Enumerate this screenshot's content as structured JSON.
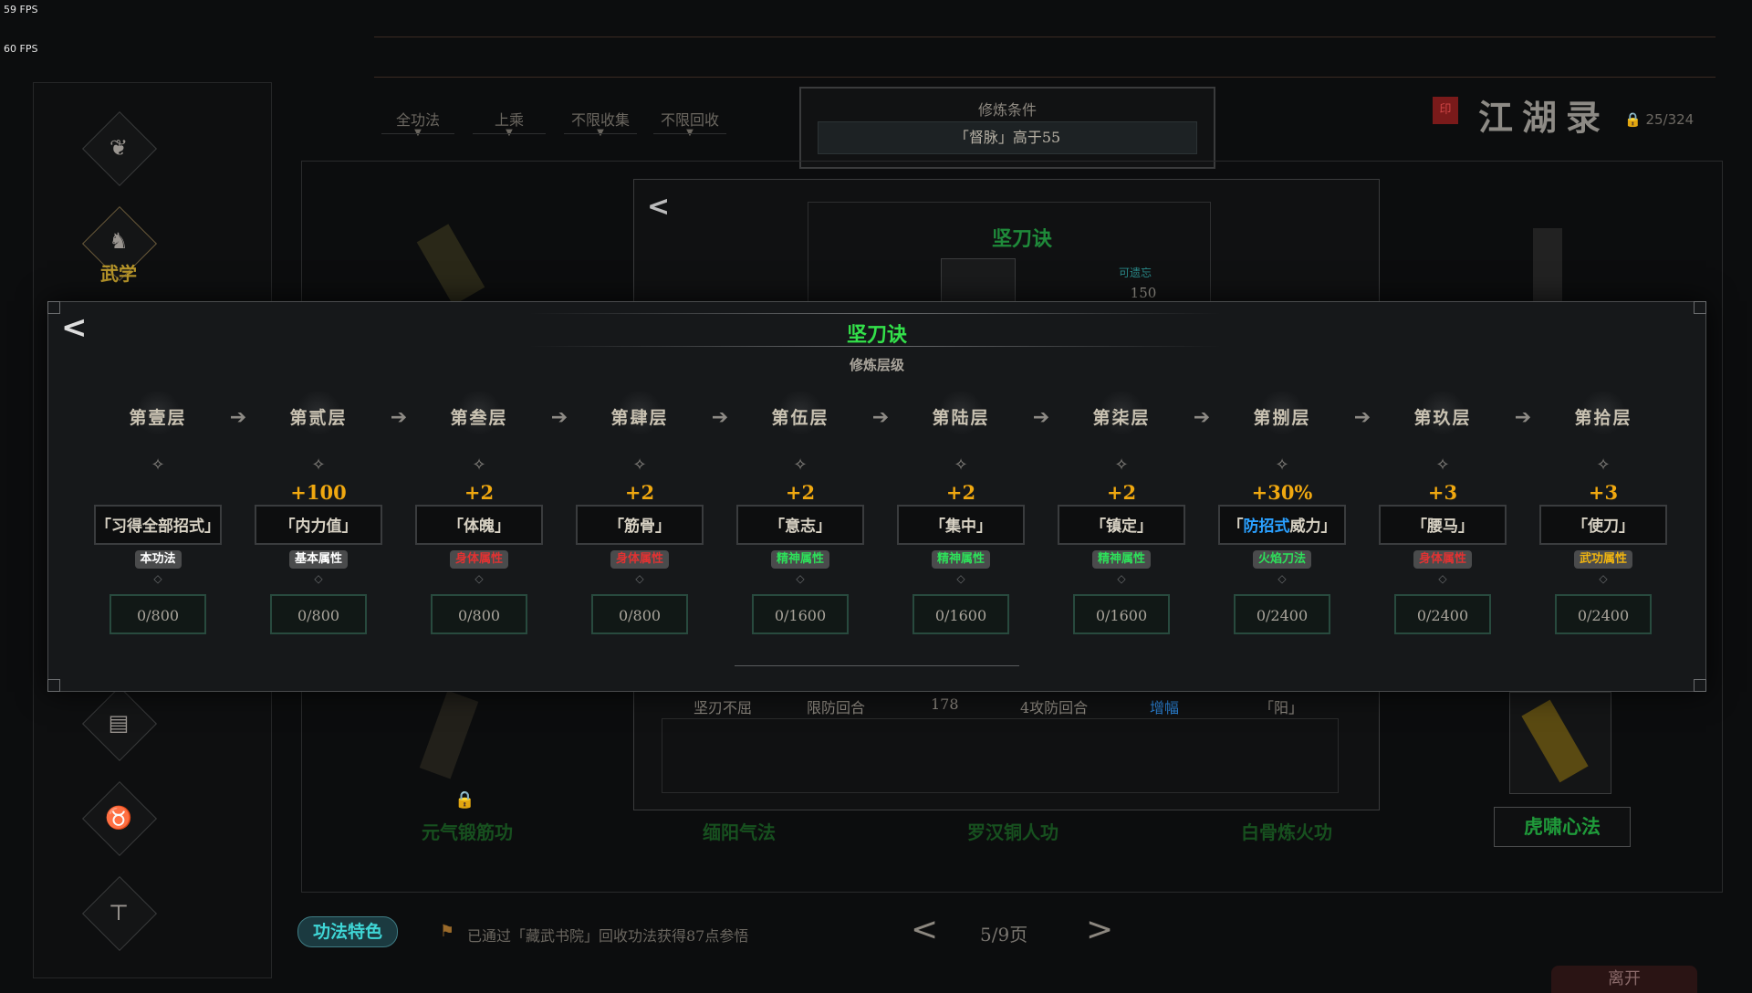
{
  "fps": [
    "59 FPS",
    "60 FPS"
  ],
  "sidebar": {
    "items": [
      {
        "icon": "beast-icon",
        "label": ""
      },
      {
        "icon": "martial-arts-icon",
        "label": "武学"
      },
      {
        "icon": "book-icon",
        "label": ""
      },
      {
        "icon": "pet-icon",
        "label": ""
      },
      {
        "icon": "clothing-icon",
        "label": ""
      }
    ]
  },
  "filters": [
    "全功法",
    "上乘",
    "不限收集",
    "不限回收"
  ],
  "condition": {
    "title": "修炼条件",
    "value": "「督脉」高于55"
  },
  "book": {
    "title": "江湖录",
    "seal": "印",
    "count": "25/324"
  },
  "background_panel": {
    "skill_name": "坚刀诀",
    "forget_label": "可遗忘",
    "forget_value": "150",
    "row": [
      "坚刃不屈",
      "限防回合",
      "178",
      "4攻防回合",
      "增幅",
      "「阳」"
    ],
    "skills": [
      "元气锻筋功",
      "缅阳气法",
      "罗汉铜人功",
      "白骨炼火功"
    ],
    "highlight_skill": "虎啸心法"
  },
  "bottom": {
    "feature_button": "功法特色",
    "notice": "已通过「藏武书院」回收功法获得87点参悟",
    "page": "5/9页",
    "prev": "<",
    "next": ">",
    "leave_button": "离开"
  },
  "modal": {
    "title": "坚刀诀",
    "subtitle": "修炼层级",
    "back": "<",
    "layers": [
      {
        "name": "第壹层",
        "bonus": "",
        "attr": "「习得全部招式」",
        "tag": "本功法",
        "tag_color": "white",
        "progress": "0/800"
      },
      {
        "name": "第贰层",
        "bonus": "+100",
        "attr": "「内力值」",
        "tag": "基本属性",
        "tag_color": "white",
        "progress": "0/800"
      },
      {
        "name": "第叁层",
        "bonus": "+2",
        "attr": "「体魄」",
        "tag": "身体属性",
        "tag_color": "red",
        "progress": "0/800"
      },
      {
        "name": "第肆层",
        "bonus": "+2",
        "attr": "「筋骨」",
        "tag": "身体属性",
        "tag_color": "red",
        "progress": "0/800"
      },
      {
        "name": "第伍层",
        "bonus": "+2",
        "attr": "「意志」",
        "tag": "精神属性",
        "tag_color": "green",
        "progress": "0/1600"
      },
      {
        "name": "第陆层",
        "bonus": "+2",
        "attr": "「集中」",
        "tag": "精神属性",
        "tag_color": "green",
        "progress": "0/1600"
      },
      {
        "name": "第柒层",
        "bonus": "+2",
        "attr": "「镇定」",
        "tag": "精神属性",
        "tag_color": "green",
        "progress": "0/1600"
      },
      {
        "name": "第捌层",
        "bonus": "+30%",
        "attr_pre": "「",
        "attr_blue": "防招式",
        "attr_post": "威力」",
        "attr": "「防招式威力」",
        "tag": "火焰刀法",
        "tag_color": "green",
        "progress": "0/2400"
      },
      {
        "name": "第玖层",
        "bonus": "+3",
        "attr": "「腰马」",
        "tag": "身体属性",
        "tag_color": "red",
        "progress": "0/2400"
      },
      {
        "name": "第拾层",
        "bonus": "+3",
        "attr": "「使刀」",
        "tag": "武功属性",
        "tag_color": "yellow",
        "progress": "0/2400"
      }
    ]
  }
}
